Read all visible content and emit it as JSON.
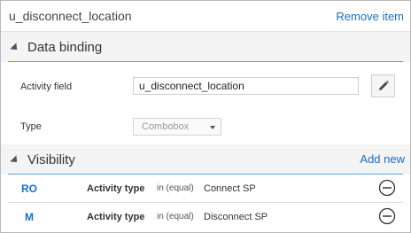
{
  "header": {
    "title": "u_disconnect_location",
    "remove_item": "Remove item"
  },
  "data_binding": {
    "title": "Data binding",
    "activity_field_label": "Activity field",
    "activity_field_value": "u_disconnect_location",
    "type_label": "Type",
    "type_value": "Combobox"
  },
  "visibility": {
    "title": "Visibility",
    "add_new": "Add new",
    "rows": [
      {
        "code": "RO",
        "field": "Activity type",
        "operator": "in (equal)",
        "value": "Connect SP"
      },
      {
        "code": "M",
        "field": "Activity type",
        "operator": "in (equal)",
        "value": "Disconnect SP"
      }
    ]
  },
  "colors": {
    "accent": "#1a6fc4",
    "section_rule": "#5aa3dc"
  }
}
